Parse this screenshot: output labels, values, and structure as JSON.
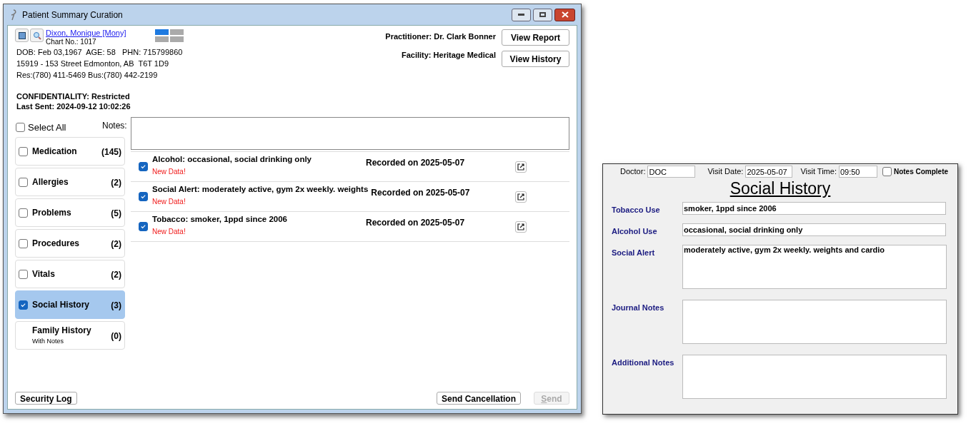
{
  "window": {
    "title": "Patient Summary Curation"
  },
  "patient": {
    "name": "Dixon, Monique [Mony]",
    "chart_no": "Chart No.: 1017",
    "dob_line": "DOB: Feb 03,1967  AGE: 58   PHN: 715799860",
    "address": "15919 - 153 Street Edmonton, AB  T6T 1D9",
    "phones": "Res:(780) 411-5469 Bus:(780) 442-2199",
    "confidentiality": "CONFIDENTIALITY: Restricted",
    "last_sent": "Last Sent: 2024-09-12 10:02:26"
  },
  "practitioner": "Practitioner: Dr. Clark Bonner",
  "facility": "Facility: Heritage Medical",
  "top_buttons": [
    "View Report",
    "View History"
  ],
  "select_all": {
    "label": "Select All",
    "checked": false
  },
  "notes_label": "Notes:",
  "categories": [
    {
      "kind": "checkbox",
      "label": "Medication",
      "count": "(145)",
      "checked": false,
      "selected": false
    },
    {
      "kind": "checkbox",
      "label": "Allergies",
      "count": "(2)",
      "checked": false,
      "selected": false
    },
    {
      "kind": "checkbox",
      "label": "Problems",
      "count": "(5)",
      "checked": false,
      "selected": false
    },
    {
      "kind": "checkbox",
      "label": "Procedures",
      "count": "(2)",
      "checked": false,
      "selected": false
    },
    {
      "kind": "checkbox",
      "label": "Vitals",
      "count": "(2)",
      "checked": false,
      "selected": false
    },
    {
      "kind": "checkbox",
      "label": "Social History",
      "count": "(3)",
      "checked": true,
      "selected": true
    },
    {
      "kind": "plain",
      "label": "Family History",
      "count": "(0)",
      "subtitle": "With Notes",
      "selected": false
    }
  ],
  "items": [
    {
      "text": "Alcohol: occasional, social drinking only",
      "status": "New Data!",
      "recorded": "Recorded on 2025-05-07",
      "checked": true
    },
    {
      "text": "Social Alert: moderately active, gym 2x weekly. weights",
      "status": "New Data!",
      "recorded": "Recorded on 2025-05-07",
      "checked": true
    },
    {
      "text": "Tobacco: smoker, 1ppd since 2006",
      "status": "New Data!",
      "recorded": "Recorded on 2025-05-07",
      "checked": true
    }
  ],
  "bottom": {
    "security_log": "Security Log",
    "send_cancellation": "Send Cancellation",
    "send": {
      "label": "Send",
      "disabled": true
    }
  },
  "form": {
    "doctor": {
      "label": "Doctor:",
      "value": "DOC"
    },
    "visit_date": {
      "label": "Visit Date:",
      "value": "2025-05-07"
    },
    "visit_time": {
      "label": "Visit Time:",
      "value": "09:50"
    },
    "notes_complete": {
      "label": "Notes Complete",
      "checked": false
    },
    "title": "Social History",
    "fields": [
      {
        "kind": "line",
        "label": "Tobacco Use",
        "value": "smoker, 1ppd since 2006"
      },
      {
        "kind": "line",
        "label": "Alcohol Use",
        "value": "occasional, social drinking only"
      },
      {
        "kind": "area",
        "label": "Social Alert",
        "value": "moderately active, gym 2x weekly. weights and cardio"
      },
      {
        "kind": "area",
        "label": "Journal Notes"
      },
      {
        "kind": "area",
        "label": "Additional Notes"
      }
    ]
  }
}
